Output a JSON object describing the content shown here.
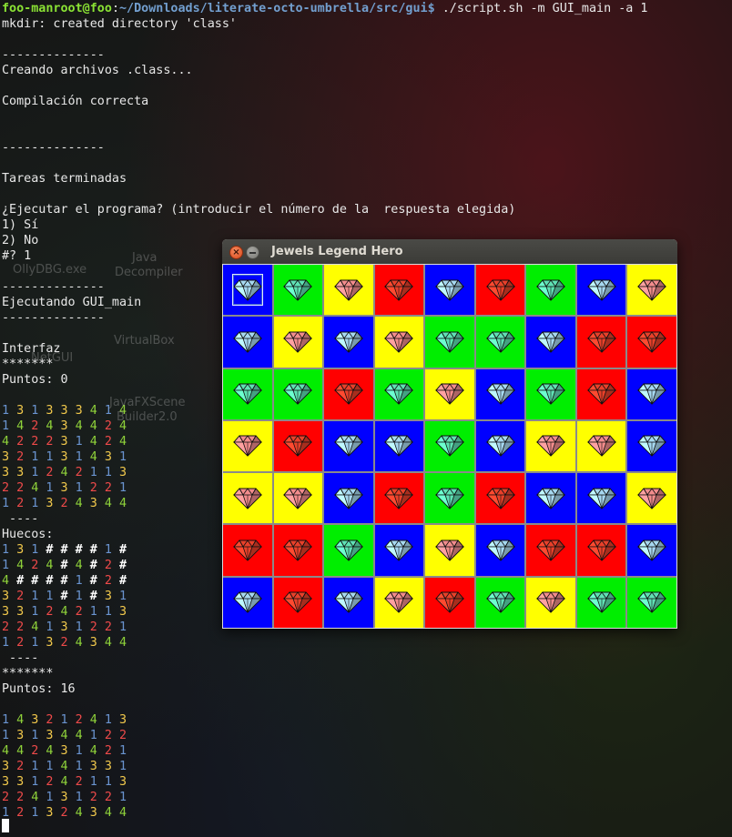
{
  "terminal": {
    "prompt_user": "foo-manroot@foo",
    "prompt_sep": ":",
    "prompt_path": "~/Downloads/literate-octo-umbrella/src/gui$",
    "command": " ./script.sh -m GUI_main -a 1",
    "plain_lines": [
      "mkdir: created directory 'class'",
      "--------------",
      "Creando archivos .class...",
      "Compilación correcta",
      "--------------",
      "Tareas terminadas",
      "¿Ejecutar el programa? (introducir el número de la  respuesta elegida)",
      "1) Sí",
      "2) No",
      "#? 1",
      "--------------",
      "Ejecutando GUI_main",
      "--------------",
      "Interfaz",
      "*******",
      "Puntos: 0",
      " ----",
      "Huecos:",
      " ----",
      "*******",
      "Puntos: 16"
    ],
    "grid_initial": [
      "1 3 1 3 3 3 4 1 4",
      "1 4 2 4 3 4 4 2 4",
      "4 2 2 2 3 1 4 2 4",
      "3 2 1 1 3 1 4 3 1",
      "3 3 1 2 4 2 1 1 3",
      "2 2 4 1 3 1 2 2 1",
      "1 2 1 3 2 4 3 4 4"
    ],
    "grid_holes": [
      "1 3 1 # # # # 1 #",
      "1 4 2 4 # 4 # 2 #",
      "4 # # # # 1 # 2 #",
      "3 2 1 1 # 1 # 3 1",
      "3 3 1 2 4 2 1 1 3",
      "2 2 4 1 3 1 2 2 1",
      "1 2 1 3 2 4 3 4 4"
    ],
    "grid_final": [
      "1 4 3 2 1 2 4 1 3",
      "1 3 1 3 4 4 1 2 2",
      "4 4 2 4 3 1 4 2 1",
      "3 2 1 1 4 1 3 3 1",
      "3 3 1 2 4 2 1 1 3",
      "2 2 4 1 3 1 2 2 1",
      "1 2 1 3 2 4 3 4 4"
    ]
  },
  "desktop_labels": [
    "OllyDBG.exe",
    "Java",
    "Decompiler",
    "VirtualBox",
    "NetGUI",
    "JavaFXScene",
    "Builder2.0"
  ],
  "window": {
    "title": "Jewels Legend Hero",
    "close_symbol": "×",
    "selected_cell": [
      0,
      0
    ],
    "board": [
      [
        "blue",
        "green",
        "yellow",
        "red",
        "blue",
        "red",
        "green",
        "blue",
        "yellow"
      ],
      [
        "blue",
        "yellow",
        "blue",
        "yellow",
        "green",
        "green",
        "blue",
        "red",
        "red"
      ],
      [
        "green",
        "green",
        "red",
        "green",
        "yellow",
        "blue",
        "green",
        "red",
        "blue"
      ],
      [
        "yellow",
        "red",
        "blue",
        "blue",
        "green",
        "blue",
        "yellow",
        "yellow",
        "blue"
      ],
      [
        "yellow",
        "yellow",
        "blue",
        "red",
        "green",
        "red",
        "blue",
        "blue",
        "yellow"
      ],
      [
        "red",
        "red",
        "green",
        "blue",
        "yellow",
        "blue",
        "red",
        "red",
        "blue"
      ],
      [
        "blue",
        "red",
        "blue",
        "yellow",
        "red",
        "green",
        "yellow",
        "green",
        "green"
      ]
    ],
    "colors": {
      "blue": {
        "bg": "#0000ff",
        "gem": "#a6d8f0"
      },
      "green": {
        "bg": "#00ee00",
        "gem": "#5fe0b4"
      },
      "yellow": {
        "bg": "#ffff00",
        "gem": "#f28c8c"
      },
      "red": {
        "bg": "#ff0000",
        "gem": "#e8402a"
      }
    },
    "gem_icon": "diamond-icon"
  }
}
